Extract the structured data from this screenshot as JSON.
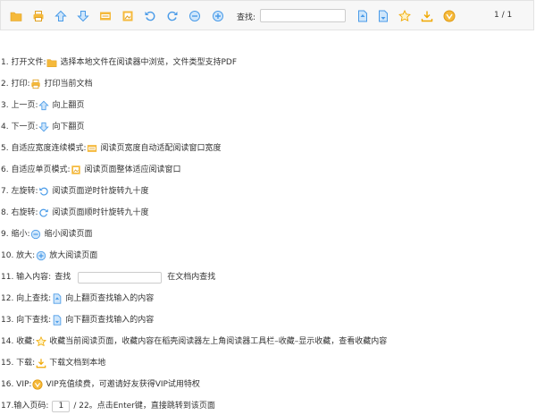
{
  "toolbar": {
    "search_label": "查找:",
    "search_value": "",
    "page_indicator": "1 / 1",
    "icons": [
      "folder-icon",
      "print-icon",
      "arrow-up-icon",
      "arrow-down-icon",
      "fit-width-icon",
      "fit-page-icon",
      "rotate-left-icon",
      "rotate-right-icon",
      "zoom-out-icon",
      "zoom-in-icon",
      "search-up-icon",
      "search-down-icon",
      "star-icon",
      "download-icon",
      "vip-icon"
    ]
  },
  "lines": [
    {
      "prefix": "1. 打开文件:",
      "desc": "选择本地文件在阅读器中浏览，文件类型支持PDF"
    },
    {
      "prefix": "2. 打印:",
      "desc": "打印当前文档"
    },
    {
      "prefix": "3. 上一页:",
      "desc": "向上翻页"
    },
    {
      "prefix": "4. 下一页:",
      "desc": "向下翻页"
    },
    {
      "prefix": "5. 自适应宽度连续模式:",
      "desc": "阅读页宽度自动适配阅读窗口宽度"
    },
    {
      "prefix": "6. 自适应单页模式:",
      "desc": "阅读页面整体适应阅读窗口"
    },
    {
      "prefix": "7. 左旋转:",
      "desc": "阅读页面逆时针旋转九十度"
    },
    {
      "prefix": "8. 右旋转:",
      "desc": "阅读页面顺时针旋转九十度"
    },
    {
      "prefix": "9. 缩小:",
      "desc": "缩小阅读页面"
    },
    {
      "prefix": "10. 放大:",
      "desc": "放大阅读页面"
    },
    {
      "prefix": "11. 输入内容:",
      "mid": "查找",
      "desc": "在文档内查找"
    },
    {
      "prefix": "12. 向上查找:",
      "desc": "向上翻页查找输入的内容"
    },
    {
      "prefix": "13. 向下查找:",
      "desc": "向下翻页查找输入的内容"
    },
    {
      "prefix": "14. 收藏:",
      "desc": "收藏当前阅读页面，收藏内容在稻壳阅读器左上角阅读器工具栏–收藏–显示收藏，查看收藏内容"
    },
    {
      "prefix": "15. 下载:",
      "desc": "下载文档到本地"
    },
    {
      "prefix": "16. VIP:",
      "desc": "VIP充值续费，可邀请好友获得VIP试用特权"
    },
    {
      "prefix": "17.输入页码:",
      "page_value": "1",
      "desc": "/ 22。点击Enter键，直接跳转到该页面"
    }
  ]
}
